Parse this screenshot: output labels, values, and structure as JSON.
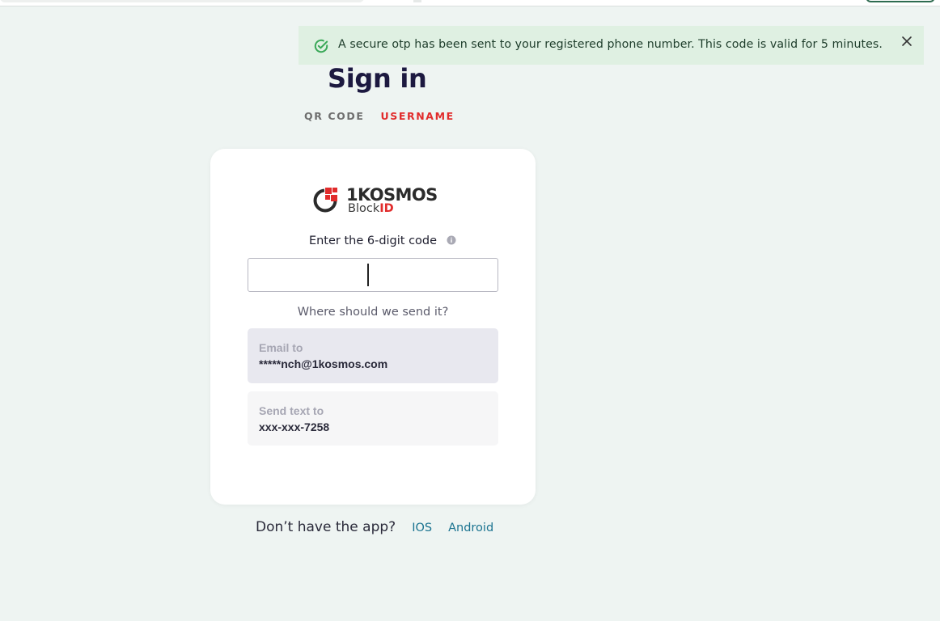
{
  "toast": {
    "message": "A secure otp has been sent to your registered phone number. This code is valid for 5 minutes.",
    "icon": "check-circle-icon",
    "close_icon": "close-icon",
    "colors": {
      "background": "#dff0e2",
      "icon": "#3aa858"
    }
  },
  "page": {
    "title": "Sign in",
    "tabs": [
      {
        "label": "QR CODE",
        "active": false
      },
      {
        "label": "USERNAME",
        "active": true
      }
    ]
  },
  "card": {
    "logo": {
      "brand": "1KOSMOS",
      "sub_prefix": "Block",
      "sub_suffix": "ID"
    },
    "code_label": "Enter the 6-digit code",
    "code_value": "",
    "info_icon": "info-icon",
    "send_prompt": "Where should we send it?",
    "options": [
      {
        "label": "Email to",
        "value": "*****nch@1kosmos.com",
        "selected": true
      },
      {
        "label": "Send text to",
        "value": "xxx-xxx-7258",
        "selected": false
      }
    ]
  },
  "footer": {
    "question": "Don’t have the app?",
    "links": [
      {
        "label": "IOS"
      },
      {
        "label": "Android"
      }
    ]
  },
  "colors": {
    "accent_red": "#e12b2b",
    "link": "#1a7390",
    "background": "#eef4f2"
  }
}
